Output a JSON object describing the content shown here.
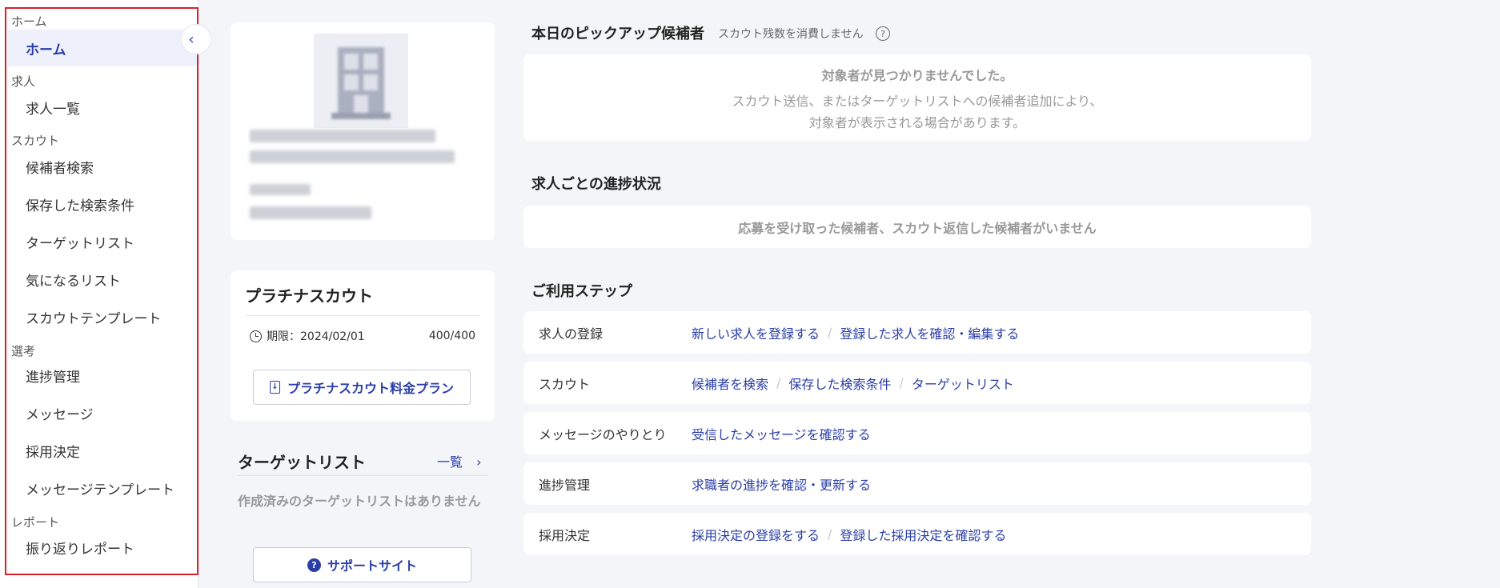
{
  "sidebar": {
    "collapse_icon": "chevron-left-icon",
    "sections": [
      {
        "label": "ホーム",
        "items": [
          "ホーム"
        ]
      },
      {
        "label": "求人",
        "items": [
          "求人一覧"
        ]
      },
      {
        "label": "スカウト",
        "items": [
          "候補者検索",
          "保存した検索条件",
          "ターゲットリスト",
          "気になるリスト",
          "スカウトテンプレート"
        ]
      },
      {
        "label": "選考",
        "items": [
          "進捗管理",
          "メッセージ",
          "採用決定",
          "メッセージテンプレート"
        ]
      },
      {
        "label": "レポート",
        "items": [
          "振り返りレポート"
        ]
      }
    ],
    "active_item": "ホーム"
  },
  "platinum": {
    "title": "プラチナスカウト",
    "expiry": "期限：2024/02/01",
    "count": "400/400",
    "plan_button": "プラチナスカウト料金プラン"
  },
  "target_list": {
    "title": "ターゲットリスト",
    "link": "一覧",
    "empty": "作成済みのターゲットリストはありません"
  },
  "support_button": "サポートサイト",
  "pickup": {
    "title": "本日のピックアップ候補者",
    "subtitle": "スカウト残数を消費しません",
    "empty_title": "対象者が見つかりませんでした。",
    "empty_line1": "スカウト送信、またはターゲットリストへの候補者追加により、",
    "empty_line2": "対象者が表示される場合があります。"
  },
  "progress": {
    "title": "求人ごとの進捗状況",
    "empty": "応募を受け取った候補者、スカウト返信した候補者がいません"
  },
  "steps": {
    "title": "ご利用ステップ",
    "rows": [
      {
        "label": "求人の登録",
        "links": [
          "新しい求人を登録する",
          "登録した求人を確認・編集する"
        ]
      },
      {
        "label": "スカウト",
        "links": [
          "候補者を検索",
          "保存した検索条件",
          "ターゲットリスト"
        ]
      },
      {
        "label": "メッセージのやりとり",
        "links": [
          "受信したメッセージを確認する"
        ]
      },
      {
        "label": "進捗管理",
        "links": [
          "求職者の進捗を確認・更新する"
        ]
      },
      {
        "label": "採用決定",
        "links": [
          "採用決定の登録をする",
          "登録した採用決定を確認する"
        ]
      }
    ]
  },
  "colors": {
    "accent": "#2a3ea8",
    "highlight_frame": "#d9202a"
  }
}
